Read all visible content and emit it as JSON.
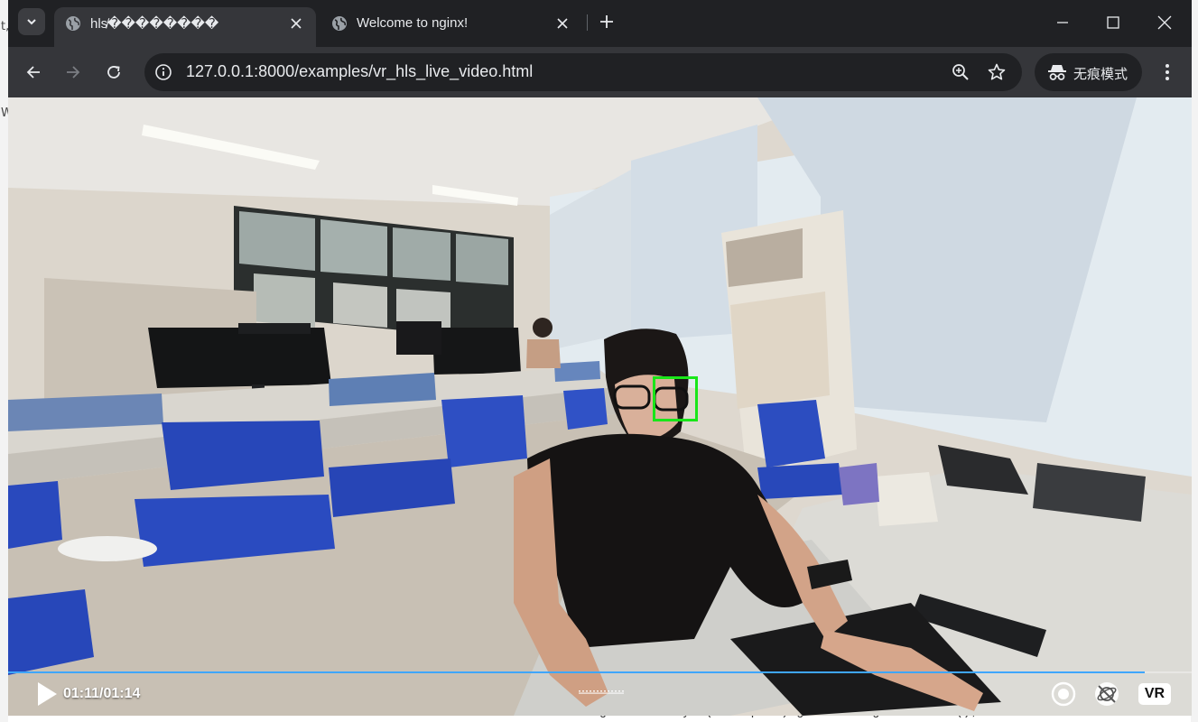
{
  "background": {
    "left_fragments": [
      "t,",
      "W"
    ],
    "code_snippet": "document.getElementById('example').getBoundingClientRect();"
  },
  "browser": {
    "tabs": [
      {
        "title": "hls⁠̸��������",
        "active": true,
        "favicon": "globe-icon"
      },
      {
        "title": "Welcome to nginx!",
        "active": false,
        "favicon": "globe-icon"
      }
    ],
    "url": "127.0.0.1:8000/examples/vr_hls_live_video.html",
    "incognito_label": "无痕模式"
  },
  "player": {
    "time": "01:11/01:14",
    "progress": 0.96,
    "vr_label": "VR"
  },
  "colors": {
    "accent_progress": "#3fa6ff",
    "face_box": "#19e619",
    "chrome_dark": "#202124",
    "chrome_toolbar": "#35363a"
  }
}
